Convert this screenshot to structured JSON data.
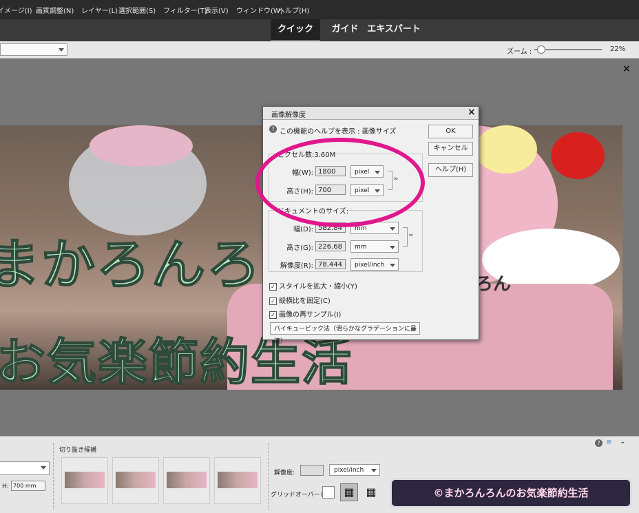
{
  "menu": [
    "イメージ(I)",
    "画質調整(N)",
    "レイヤー(L)",
    "選択範囲(S)",
    "フィルター(T)",
    "表示(V)",
    "ウィンドウ(W)",
    "ヘルプ(H)"
  ],
  "modes": {
    "quick": "クイック",
    "guided": "ガイド",
    "expert": "エキスパート"
  },
  "zoom": {
    "label": "ズーム :",
    "value": "22%",
    "level": 0.05
  },
  "canvas": {
    "close": "×",
    "text_line1": "まかろんろん",
    "text_line2": "お気楽節約生活",
    "sticker_text": "ろん"
  },
  "dialog": {
    "title": "画像解像度",
    "close": "×",
    "help_text": "この機能のヘルプを表示 : 画像サイズ",
    "ok": "OK",
    "cancel": "キャンセル",
    "help": "ヘルプ(H)",
    "pixel_group": "ピクセル数:3.60M",
    "width_label": "幅(W):",
    "width_value": "1800",
    "width_unit": "pixel",
    "height_label": "高さ(H):",
    "height_value": "700",
    "height_unit": "pixel",
    "doc_group": "ドキュメントのサイズ:",
    "doc_width_label": "幅(D):",
    "doc_width_value": "582.84",
    "doc_width_unit": "mm",
    "doc_height_label": "高さ(G):",
    "doc_height_value": "226.68",
    "doc_height_unit": "mm",
    "res_label": "解像度(R):",
    "res_value": "78.444",
    "res_unit": "pixel/inch",
    "scale_styles": "スタイルを拡大・縮小(Y)",
    "constrain": "縦横比を固定(C)",
    "resample": "画像の再サンプル(I)",
    "resample_method": "バイキュービック法（滑らかなグラデーションに最適）"
  },
  "bottom": {
    "crop_label": "切り抜き候補",
    "h_label": "H:",
    "h_value": "700 mm",
    "resolution_label": "解像度:",
    "resolution_unit": "pixel/inch",
    "grid_label": "グリッドオーバーレイ:",
    "watermark": "©まかろんろんのお気楽節約生活"
  },
  "colors": {
    "accent_ring": "#e0178d",
    "link": "#1a4fd6"
  }
}
